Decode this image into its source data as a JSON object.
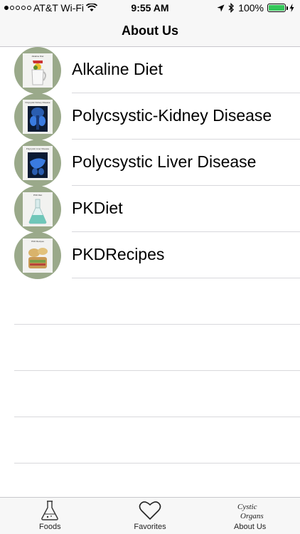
{
  "status_bar": {
    "carrier": "AT&T Wi-Fi",
    "time": "9:55 AM",
    "battery": "100%",
    "battery_level": 1.0
  },
  "nav": {
    "title": "About Us"
  },
  "list": {
    "items": [
      {
        "label": "Alkaline Diet",
        "thumb_caption": "Alkaline Diet",
        "icon": "pitcher-icon"
      },
      {
        "label": "Polycsystic-Kidney Disease",
        "thumb_caption": "Polycystic Kidney Disease",
        "icon": "kidney-icon"
      },
      {
        "label": "Polycsystic Liver Disease",
        "thumb_caption": "Polycystic Liver Disease",
        "icon": "liver-icon"
      },
      {
        "label": "PKDiet",
        "thumb_caption": "PKD Diet",
        "icon": "flask-icon"
      },
      {
        "label": "PKDRecipes",
        "thumb_caption": "PKD Recipes",
        "icon": "food-icon"
      }
    ]
  },
  "tabs": [
    {
      "label": "Foods",
      "icon": "flask-outline-icon"
    },
    {
      "label": "Favorites",
      "icon": "heart-outline-icon"
    },
    {
      "label": "About Us",
      "icon": "cystic-organs-logo-icon",
      "logo_text": "Cystic Organs"
    }
  ]
}
